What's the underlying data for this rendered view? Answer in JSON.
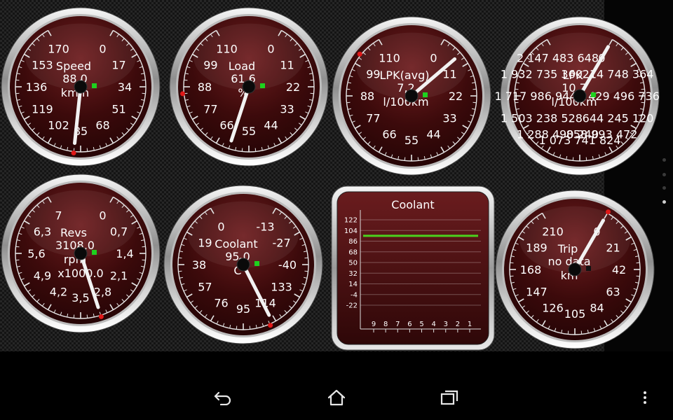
{
  "gauges": [
    {
      "key": "speed",
      "title": "Speed",
      "value": "88,0",
      "unit": "km/h",
      "unit2": "",
      "ticks": [
        "0",
        "17",
        "34",
        "51",
        "68",
        "85",
        "102",
        "119",
        "136",
        "153",
        "170"
      ],
      "needle_fraction": 0.52,
      "red_marker_fraction": 0.52,
      "indicator": "green"
    },
    {
      "key": "load",
      "title": "Load",
      "value": "61,6",
      "unit": "%",
      "unit2": "",
      "ticks": [
        "0",
        "11",
        "22",
        "33",
        "44",
        "55",
        "66",
        "77",
        "88",
        "99",
        "110"
      ],
      "needle_fraction": 0.56,
      "red_marker_fraction": 0.78,
      "indicator": "green"
    },
    {
      "key": "lpk_avg",
      "title": "LPK(avg)",
      "value": "7,2",
      "unit": "l/100km",
      "unit2": "",
      "ticks": [
        "0",
        "11",
        "22",
        "33",
        "44",
        "55",
        "66",
        "77",
        "88",
        "99",
        "110"
      ],
      "needle_fraction": 0.065,
      "red_marker_fraction": 0.93,
      "indicator": "green"
    },
    {
      "key": "lpk",
      "title": "LPK",
      "value": "10,7",
      "unit": "l/100km",
      "unit2": "",
      "ticks": [
        "0",
        "214 748 364",
        "429 496 736",
        "644 245 120",
        "858 993 472",
        "1 073 741 824",
        "1 288 490 240",
        "1 503 238 528",
        "1 717 986 944",
        "1 932 735 360",
        "2 147 483 648"
      ],
      "needle_fraction": 0.0,
      "red_marker_fraction": null,
      "indicator": "green"
    },
    {
      "key": "revs",
      "title": "Revs",
      "value": "3108,0",
      "unit": "rpm",
      "unit2": "x1000.0",
      "ticks": [
        "0",
        "0,7",
        "1,4",
        "2,1",
        "2,8",
        "3,5",
        "4,2",
        "4,9",
        "5,6",
        "6,3",
        "7"
      ],
      "needle_fraction": 0.44,
      "red_marker_fraction": 0.44,
      "indicator": "green"
    },
    {
      "key": "coolant_gauge",
      "title": "Coolant",
      "value": "95,0",
      "unit": "C",
      "unit2": "",
      "ticks": [
        "-13",
        "-27",
        "-40",
        "133",
        "114",
        "95",
        "76",
        "57",
        "38",
        "19",
        "0"
      ],
      "needle_fraction": 0.41,
      "red_marker_fraction": 0.42,
      "indicator": "green"
    },
    {
      "key": "trip",
      "title": "Trip",
      "value": "no data",
      "unit": "km",
      "unit2": "",
      "ticks": [
        "0",
        "21",
        "42",
        "63",
        "84",
        "105",
        "126",
        "147",
        "168",
        "189",
        "210"
      ],
      "needle_fraction": 0.0,
      "red_marker_fraction": 0.0,
      "indicator": "black"
    }
  ],
  "coolant_chart": {
    "chart_data": {
      "type": "line",
      "title": "Coolant",
      "x": [
        9,
        8,
        7,
        6,
        5,
        4,
        3,
        2,
        1
      ],
      "x_tick_labels": [
        "9",
        "8",
        "7",
        "6",
        "5",
        "4",
        "3",
        "2",
        "1"
      ],
      "y_tick_labels": [
        "122",
        "104",
        "86",
        "68",
        "50",
        "32",
        "14",
        "-4",
        "-22"
      ],
      "ylim": [
        -22,
        122
      ],
      "series": [
        {
          "values": [
            95,
            95,
            95,
            95,
            95,
            95,
            95,
            95,
            95
          ],
          "color": "#4bd11e"
        }
      ],
      "grid": true,
      "legend": "none"
    }
  },
  "pager": {
    "total": 4,
    "active_index": 3
  },
  "nav": {
    "back": "back-icon",
    "home": "home-icon",
    "recents": "recents-icon",
    "menu": "overflow-menu-icon"
  },
  "colors": {
    "dial_face": "#3c0a0b",
    "needle": "#f2f2f2",
    "red_marker": "#e01818",
    "indicator_green": "#1ed21e",
    "chart_line": "#4bd11e"
  }
}
